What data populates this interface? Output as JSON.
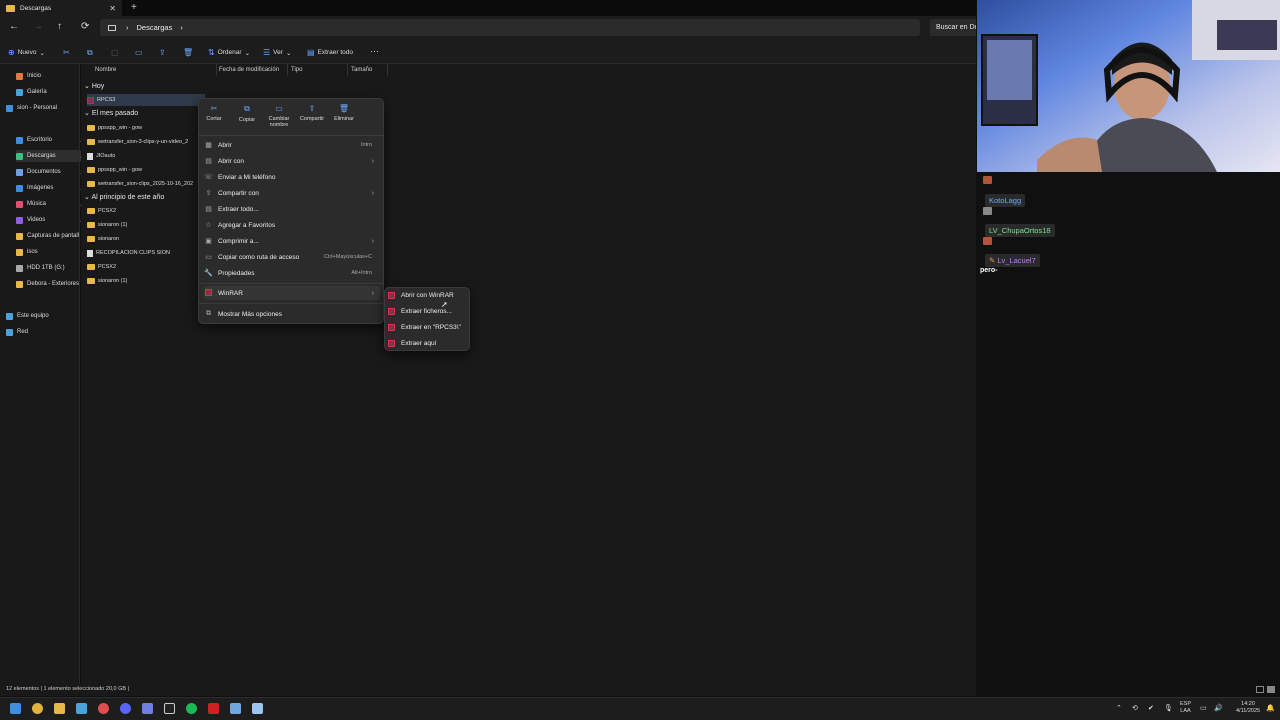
{
  "window": {
    "tab_title": "Descargas",
    "new_tab": "+",
    "close": "✕"
  },
  "nav": {
    "back": "←",
    "forward": "→",
    "up": "↑",
    "refresh": "⟳",
    "breadcrumb": [
      "Descargas"
    ],
    "search_placeholder": "Buscar en De"
  },
  "command_bar": {
    "new_label": "Nuevo",
    "sort_label": "Ordenar",
    "view_label": "Ver",
    "extract_all_label": "Extraer todo",
    "more": "···"
  },
  "sidebar": {
    "items": [
      {
        "label": "Inicio",
        "icon": "home-icon",
        "color": "#e07a3f"
      },
      {
        "label": "Galería",
        "icon": "gallery-icon",
        "color": "#4aa3df"
      },
      {
        "label": "sion - Personal",
        "icon": "cloud-icon",
        "color": "#3f8fe0"
      },
      {
        "label": "Escritorio",
        "icon": "desktop-icon",
        "color": "#3f8fe0"
      },
      {
        "label": "Descargas",
        "icon": "download-icon",
        "color": "#3fbf7f"
      },
      {
        "label": "Documentos",
        "icon": "documents-icon",
        "color": "#6f9fe8"
      },
      {
        "label": "Imágenes",
        "icon": "pictures-icon",
        "color": "#3f8fe0"
      },
      {
        "label": "Música",
        "icon": "music-icon",
        "color": "#e04f6f"
      },
      {
        "label": "Videos",
        "icon": "videos-icon",
        "color": "#8f5fe0"
      },
      {
        "label": "Capturas de pantall",
        "icon": "folder-icon",
        "color": "#e8b84a"
      },
      {
        "label": "isos",
        "icon": "folder-icon",
        "color": "#e8b84a"
      },
      {
        "label": "HDD 1TB (G:)",
        "icon": "drive-icon",
        "color": "#aaaaaa"
      },
      {
        "label": "Debora - Exteriores",
        "icon": "folder-icon",
        "color": "#e8b84a"
      },
      {
        "label": "Este equipo",
        "icon": "pc-icon",
        "color": "#4aa3df"
      },
      {
        "label": "Red",
        "icon": "network-icon",
        "color": "#4aa3df"
      }
    ]
  },
  "columns": [
    "Nombre",
    "Fecha de modificación",
    "Tipo",
    "Tamaño"
  ],
  "groups": {
    "today": "Hoy",
    "last_month": "El mes pasado",
    "early_year": "Al principio de este año"
  },
  "files": {
    "today": [
      {
        "name": "RPCS3",
        "icon": "rar"
      }
    ],
    "last_month": [
      {
        "name": "ppsspp_win - gow",
        "icon": "folder"
      },
      {
        "name": "wetransfer_sion-3-clips-y-un-video_2",
        "icon": "folder"
      },
      {
        "name": "JIOauto",
        "icon": "file"
      },
      {
        "name": "ppsspp_win - gow",
        "icon": "folder"
      },
      {
        "name": "wetransfer_sion-clips_2025-10-16_202",
        "icon": "folder"
      }
    ],
    "early_year": [
      {
        "name": "PCSX2",
        "icon": "folder"
      },
      {
        "name": "sionaron (1)",
        "icon": "folder"
      },
      {
        "name": "sionaron",
        "icon": "folder"
      },
      {
        "name": "RECOPILACION CLIPS SION",
        "icon": "file"
      },
      {
        "name": "PCSX2",
        "icon": "folder"
      },
      {
        "name": "sionaron (1)",
        "icon": "folder"
      }
    ]
  },
  "context_menu": {
    "quick": [
      "Cortar",
      "Copiar",
      "Cambiar nombre",
      "Compartir",
      "Eliminar"
    ],
    "items": [
      {
        "label": "Abrir",
        "shortcut": "Intro",
        "arrow": ""
      },
      {
        "label": "Abrir con",
        "shortcut": "",
        "arrow": "›"
      },
      {
        "label": "Enviar a Mi teléfono",
        "shortcut": "",
        "arrow": ""
      },
      {
        "label": "Compartir con",
        "shortcut": "",
        "arrow": "›"
      },
      {
        "label": "Extraer todo...",
        "shortcut": "",
        "arrow": ""
      },
      {
        "label": "Agregar a Favoritos",
        "shortcut": "",
        "arrow": ""
      },
      {
        "label": "Comprimir a...",
        "shortcut": "",
        "arrow": "›"
      },
      {
        "label": "Copiar como ruta de acceso",
        "shortcut": "Ctrl+Mayúsculas+C",
        "arrow": ""
      },
      {
        "label": "Propiedades",
        "shortcut": "Alt+Intro",
        "arrow": ""
      }
    ],
    "winrar": {
      "label": "WinRAR",
      "arrow": "›"
    },
    "more_options": "Mostrar Más opciones"
  },
  "submenu": [
    "Abrir con WinRAR",
    "Extraer ficheros...",
    "Extraer en \"RPCS3\\\"",
    "Extraer aquí"
  ],
  "status_bar": "12 elementos  |  1 elemento seleccionado 20,0 GB  |",
  "chat": {
    "users": [
      {
        "name": "KotoLagg",
        "color": "#6aa8ff"
      },
      {
        "name": "LV_ChupaOrtos18",
        "color": "#7be08f"
      },
      {
        "name": "Lv_Lacuel7",
        "color": "#c27aff"
      }
    ],
    "message": "pero-"
  },
  "tray": {
    "lang": "ESP",
    "lang2": "LAA",
    "time": "14:20",
    "date": "4/11/2025"
  }
}
